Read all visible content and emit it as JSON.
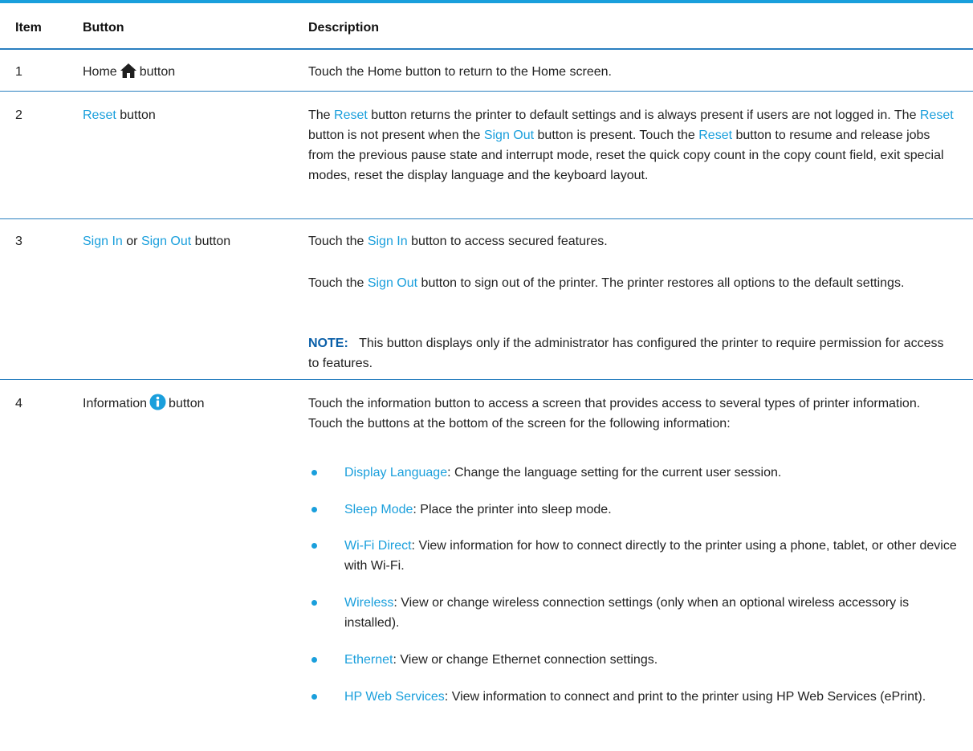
{
  "headers": {
    "item": "Item",
    "button": "Button",
    "description": "Description"
  },
  "rows": [
    {
      "item": "1",
      "btn_pre": "Home",
      "btn_post": "button",
      "desc": "Touch the Home button to return to the Home screen."
    },
    {
      "item": "2",
      "btn_link": "Reset",
      "btn_post": "button",
      "p1": "The ",
      "l1": "Reset",
      "p2": " button returns the printer to default settings and is always present if users are not logged in. The ",
      "l2": "Reset",
      "p3": " button is not present when the ",
      "l3": "Sign Out",
      "p4": " button is present. Touch the ",
      "l4": "Reset",
      "p5": " button to resume and release jobs from the previous pause state and interrupt mode, reset the quick copy count in the copy count field, exit special modes, reset the display language and the keyboard layout."
    },
    {
      "item": "3",
      "btn_link1": "Sign In",
      "btn_mid": "or",
      "btn_link2": "Sign Out",
      "btn_post": "button",
      "a_pre": "Touch the ",
      "a_link": "Sign In",
      "a_post": " button to access secured features.",
      "b_pre": "Touch the ",
      "b_link": "Sign Out",
      "b_post": " button to sign out of the printer. The printer restores all options to the default settings.",
      "note_label": "NOTE:",
      "note_text": "This button displays only if the administrator has configured the printer to require permission for access to features."
    },
    {
      "item": "4",
      "btn_pre": "Information",
      "btn_post": "button",
      "intro": "Touch the information button to access a screen that provides access to several types of printer information. Touch the buttons at the bottom of the screen for the following information:",
      "bullets": [
        {
          "link": "Display Language",
          "text": ": Change the language setting for the current user session."
        },
        {
          "link": "Sleep Mode",
          "text": ": Place the printer into sleep mode."
        },
        {
          "link": "Wi-Fi Direct",
          "text": ": View information for how to connect directly to the printer using a phone, tablet, or other device with Wi-Fi."
        },
        {
          "link": "Wireless",
          "text": ": View or change wireless connection settings (only when an optional wireless accessory is installed)."
        },
        {
          "link": "Ethernet",
          "text": ": View or change Ethernet connection settings."
        },
        {
          "link": "HP Web Services",
          "text": ": View information to connect and print to the printer using HP Web Services (ePrint)."
        }
      ]
    }
  ],
  "colors": {
    "accent": "#1a9fdc",
    "rule": "#2a7fc0",
    "note": "#0a5fa8",
    "text": "#222222"
  },
  "icons": [
    "home-icon",
    "info-icon"
  ]
}
